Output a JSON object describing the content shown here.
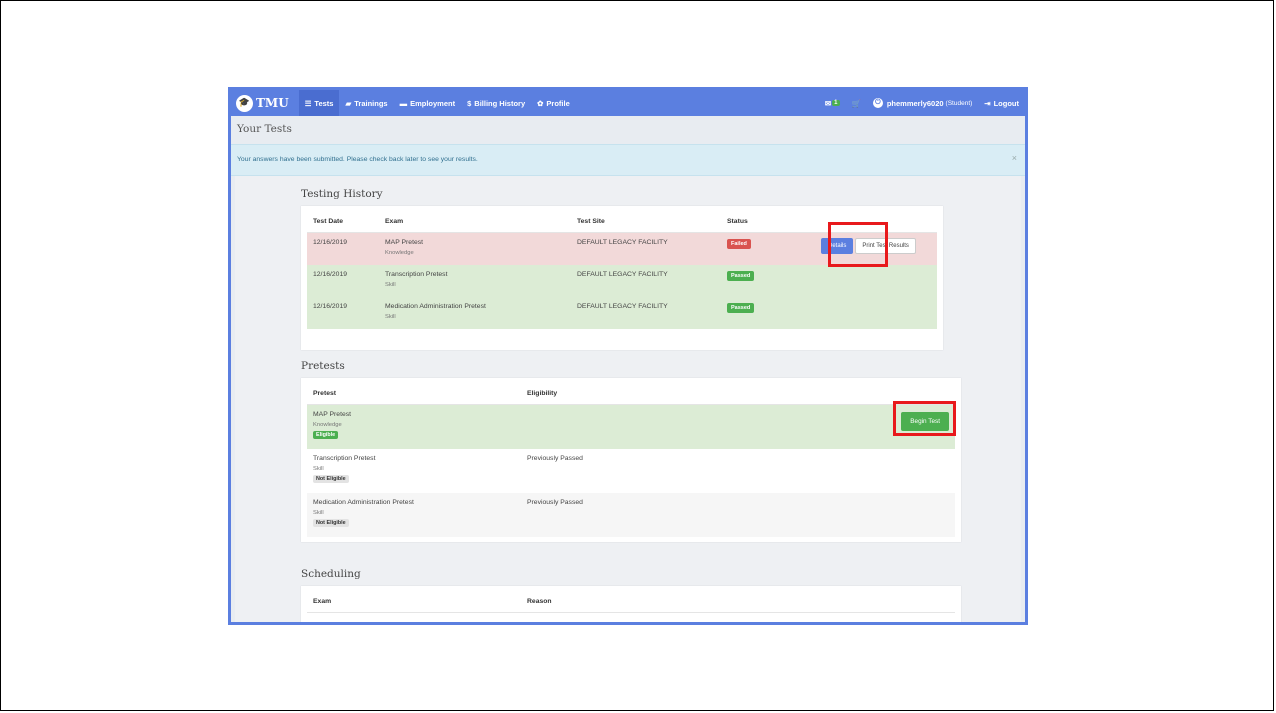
{
  "app": {
    "brand": "TMU",
    "nav": [
      {
        "label": "Tests",
        "icon": "table-icon",
        "glyph": "☰"
      },
      {
        "label": "Trainings",
        "icon": "book-icon",
        "glyph": "▰"
      },
      {
        "label": "Employment",
        "icon": "briefcase-icon",
        "glyph": "▬"
      },
      {
        "label": "Billing History",
        "icon": "dollar-icon",
        "glyph": "$"
      },
      {
        "label": "Profile",
        "icon": "gear-icon",
        "glyph": "✿"
      }
    ],
    "mail_count": "1",
    "username": "phemmerly6020",
    "role": "(Student)",
    "logout": "Logout"
  },
  "page_title": "Your Tests",
  "alert": {
    "message": "Your answers have been submitted. Please check back later to see your results.",
    "close": "×"
  },
  "testing_history": {
    "title": "Testing History",
    "headers": [
      "Test Date",
      "Exam",
      "Test Site",
      "Status"
    ],
    "rows": [
      {
        "date": "12/16/2019",
        "exam": "MAP Pretest",
        "type": "Knowledge",
        "site": "DEFAULT LEGACY FACILITY",
        "status": "Failed"
      },
      {
        "date": "12/16/2019",
        "exam": "Transcription Pretest",
        "type": "Skill",
        "site": "DEFAULT LEGACY FACILITY",
        "status": "Passed"
      },
      {
        "date": "12/16/2019",
        "exam": "Medication Administration Pretest",
        "type": "Skill",
        "site": "DEFAULT LEGACY FACILITY",
        "status": "Passed"
      }
    ],
    "details_button": "Details",
    "print_button": "Print Test Results"
  },
  "pretests": {
    "title": "Pretests",
    "headers": [
      "Pretest",
      "Eligibility"
    ],
    "rows": [
      {
        "name": "MAP Pretest",
        "type": "Knowledge",
        "badge": "Eligible",
        "eligibility": ""
      },
      {
        "name": "Transcription Pretest",
        "type": "Skill",
        "badge": "Not Eligible",
        "eligibility": "Previously Passed"
      },
      {
        "name": "Medication Administration Pretest",
        "type": "Skill",
        "badge": "Not Eligible",
        "eligibility": "Previously Passed"
      }
    ],
    "begin_button": "Begin Test"
  },
  "scheduling": {
    "title": "Scheduling",
    "headers": [
      "Exam",
      "Reason"
    ]
  },
  "colors": {
    "navbar": "#5b7fe0",
    "failed": "#d9534f",
    "passed": "#4caf50",
    "highlight": "#e8191c"
  }
}
